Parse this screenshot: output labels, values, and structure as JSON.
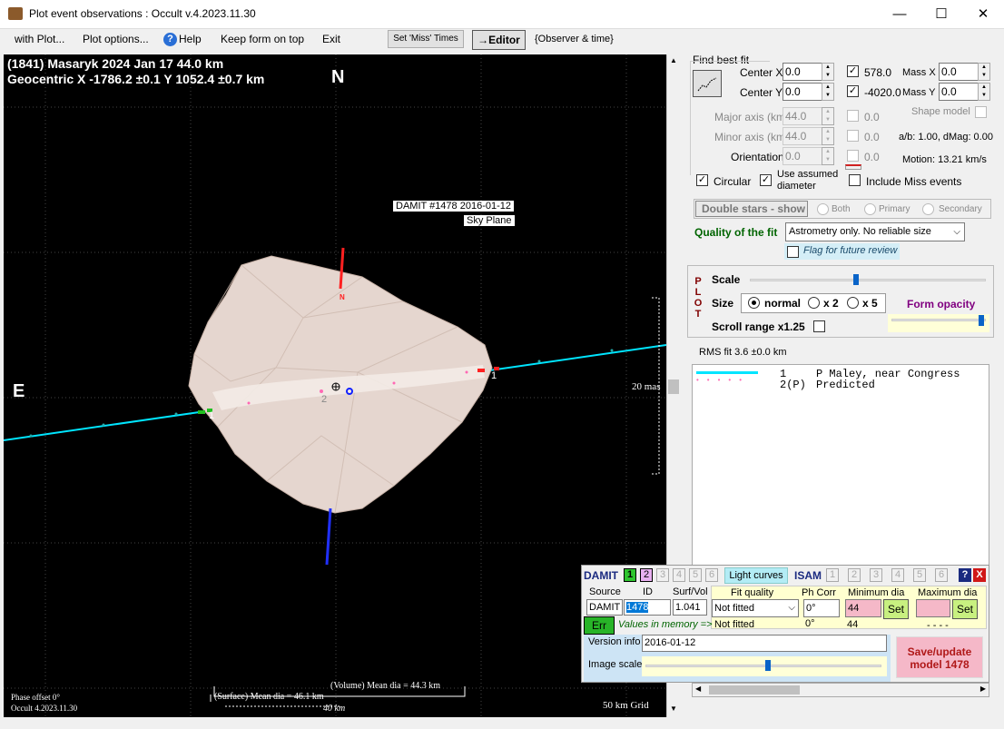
{
  "window": {
    "title": "Plot event observations : Occult v.4.2023.11.30",
    "minimize": "—",
    "maximize": "☐",
    "close": "✕"
  },
  "menu": {
    "with_plot": "with Plot...",
    "plot_options": "Plot options...",
    "help": "Help",
    "keep_on_top": "Keep form on top",
    "exit": "Exit",
    "set_miss": "Set 'Miss' Times",
    "editor": "→Editor",
    "observer_time": "{Observer & time}"
  },
  "plot": {
    "header_line1": "(1841) Masaryk  2024 Jan 17  44.0 km",
    "header_line2": "Geocentric  X  -1786.2 ±0.1  Y 1052.4 ±0.7 km",
    "north": "N",
    "east": "E",
    "model_label1": "DAMIT #1478 2016-01-12",
    "model_label2": "Sky Plane",
    "mas_label": "20 mas",
    "n_small": "N",
    "chord1": "1",
    "chord1b": "1",
    "chord2": "2",
    "phase_offset": "Phase offset 0°",
    "version": "Occult 4.2023.11.30",
    "volume_dia": "(Volume) Mean dia = 44.3 km",
    "surface_dia": "(Surface) Mean dia = 46.1 km",
    "scale_km": "40 km",
    "grid": "50 km Grid"
  },
  "fit": {
    "section": "Find best fit",
    "center_x_label": "Center X",
    "center_x": "0.0",
    "center_y_label": "Center Y",
    "center_y": "0.0",
    "val1": "578.0",
    "val2": "-4020.0",
    "mass_x_label": "Mass X",
    "mass_x": "0.0",
    "mass_y_label": "Mass Y",
    "mass_y": "0.0",
    "major_label": "Major axis (km)",
    "major": "44.0",
    "major_c": "0.0",
    "minor_label": "Minor axis (km)",
    "minor": "44.0",
    "minor_c": "0.0",
    "orient_label": "Orientation",
    "orient": "0.0",
    "orient_c": "0.0",
    "shape_model": "Shape model",
    "ab_dmag": "a/b: 1.00, dMag: 0.00",
    "motion": "Motion: 13.21 km/s",
    "circular": "Circular",
    "assumed": "Use assumed diameter",
    "include_miss": "Include Miss events",
    "double_stars": "Double stars - show",
    "both": "Both",
    "primary": "Primary",
    "secondary": "Secondary",
    "quality_label": "Quality of the fit",
    "quality_value": "Astrometry only. No reliable size",
    "flag": "Flag for future review"
  },
  "plotctl": {
    "plot_letters": [
      "P",
      "L",
      "O",
      "T"
    ],
    "scale": "Scale",
    "size": "Size",
    "normal": "normal",
    "x2": "x 2",
    "x5": "x 5",
    "form_opacity": "Form opacity",
    "scroll_range": "Scroll range x1.25",
    "scale_pct": 0.45,
    "opacity_pct": 0.98
  },
  "rms": "RMS fit 3.6 ±0.0 km",
  "legend": [
    {
      "num": "1",
      "name": "P Maley, near Congress",
      "color": "#00e5ff"
    },
    {
      "num": "2(P)",
      "name": "Predicted",
      "color": "#ff69b4"
    }
  ],
  "damit": {
    "title": "DAMIT",
    "tabs": [
      "1",
      "2",
      "3",
      "4",
      "5",
      "6"
    ],
    "light_curves": "Light curves",
    "isam": "ISAM",
    "help": "?",
    "close": "X",
    "source_label": "Source",
    "id_label": "ID",
    "surf_label": "Surf/Vol",
    "source": "DAMIT",
    "id": "1478",
    "surf": "1.041",
    "fit_quality_label": "Fit quality",
    "ph_corr_label": "Ph Corr",
    "min_dia_label": "Minimum dia",
    "max_dia_label": "Maximum dia",
    "fit_quality": "Not fitted",
    "ph_corr": "0°",
    "min_dia": "44",
    "set": "Set",
    "fit_quality2": "Not fitted",
    "ph_corr2": "0°",
    "min_dia2": "44",
    "max_dia2": "- - - -",
    "err": "Err",
    "values_memory": "Values in memory =>",
    "version_label": "Version info",
    "version": "2016-01-12",
    "image_scale": "Image scale",
    "image_scale_pct": 0.52,
    "save": "Save/update model 1478"
  }
}
